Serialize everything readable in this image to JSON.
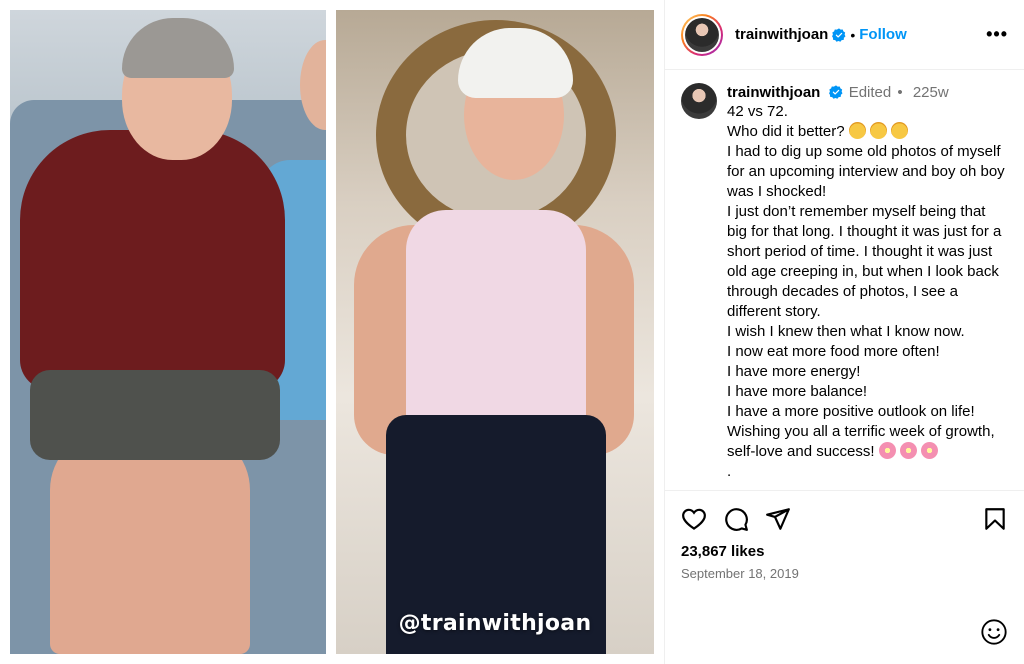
{
  "media": {
    "watermark": "@trainwithjoan"
  },
  "header": {
    "username": "trainwithjoan",
    "separator": "•",
    "follow_label": "Follow",
    "more_label": "•••",
    "icons": [
      "avatar",
      "verified-badge-icon",
      "more-options-icon"
    ]
  },
  "caption": {
    "username": "trainwithjoan",
    "edited_label": "Edited",
    "separator": "•",
    "time": "225w",
    "lines": [
      "42 vs 72.",
      "Who did it better?",
      "I had to dig up some old photos of myself for an upcoming interview and boy oh boy was I shocked!",
      "I just don’t remember myself being that big for that long. I thought it was just for a short period of time. I thought it was just old age creeping in, but when I look back through decades of photos, I see a different story.",
      "I wish I knew then what I know now.",
      "I now eat more food more often!",
      "I have more energy!",
      "I have more balance!",
      "I have a more positive outlook on life!",
      "Wishing you all a terrific week of growth, self-love and success!",
      "."
    ],
    "emoji_icons": [
      "sweat-smile-emoji",
      "cherry-blossom-emoji"
    ]
  },
  "actions": {
    "icons": [
      "heart-icon",
      "comment-icon",
      "share-icon",
      "bookmark-icon"
    ]
  },
  "likes": "23,867 likes",
  "date": "September 18, 2019",
  "colors": {
    "link_blue": "#0095f6",
    "muted_text": "#737373",
    "verified_blue": "#0095f6"
  }
}
